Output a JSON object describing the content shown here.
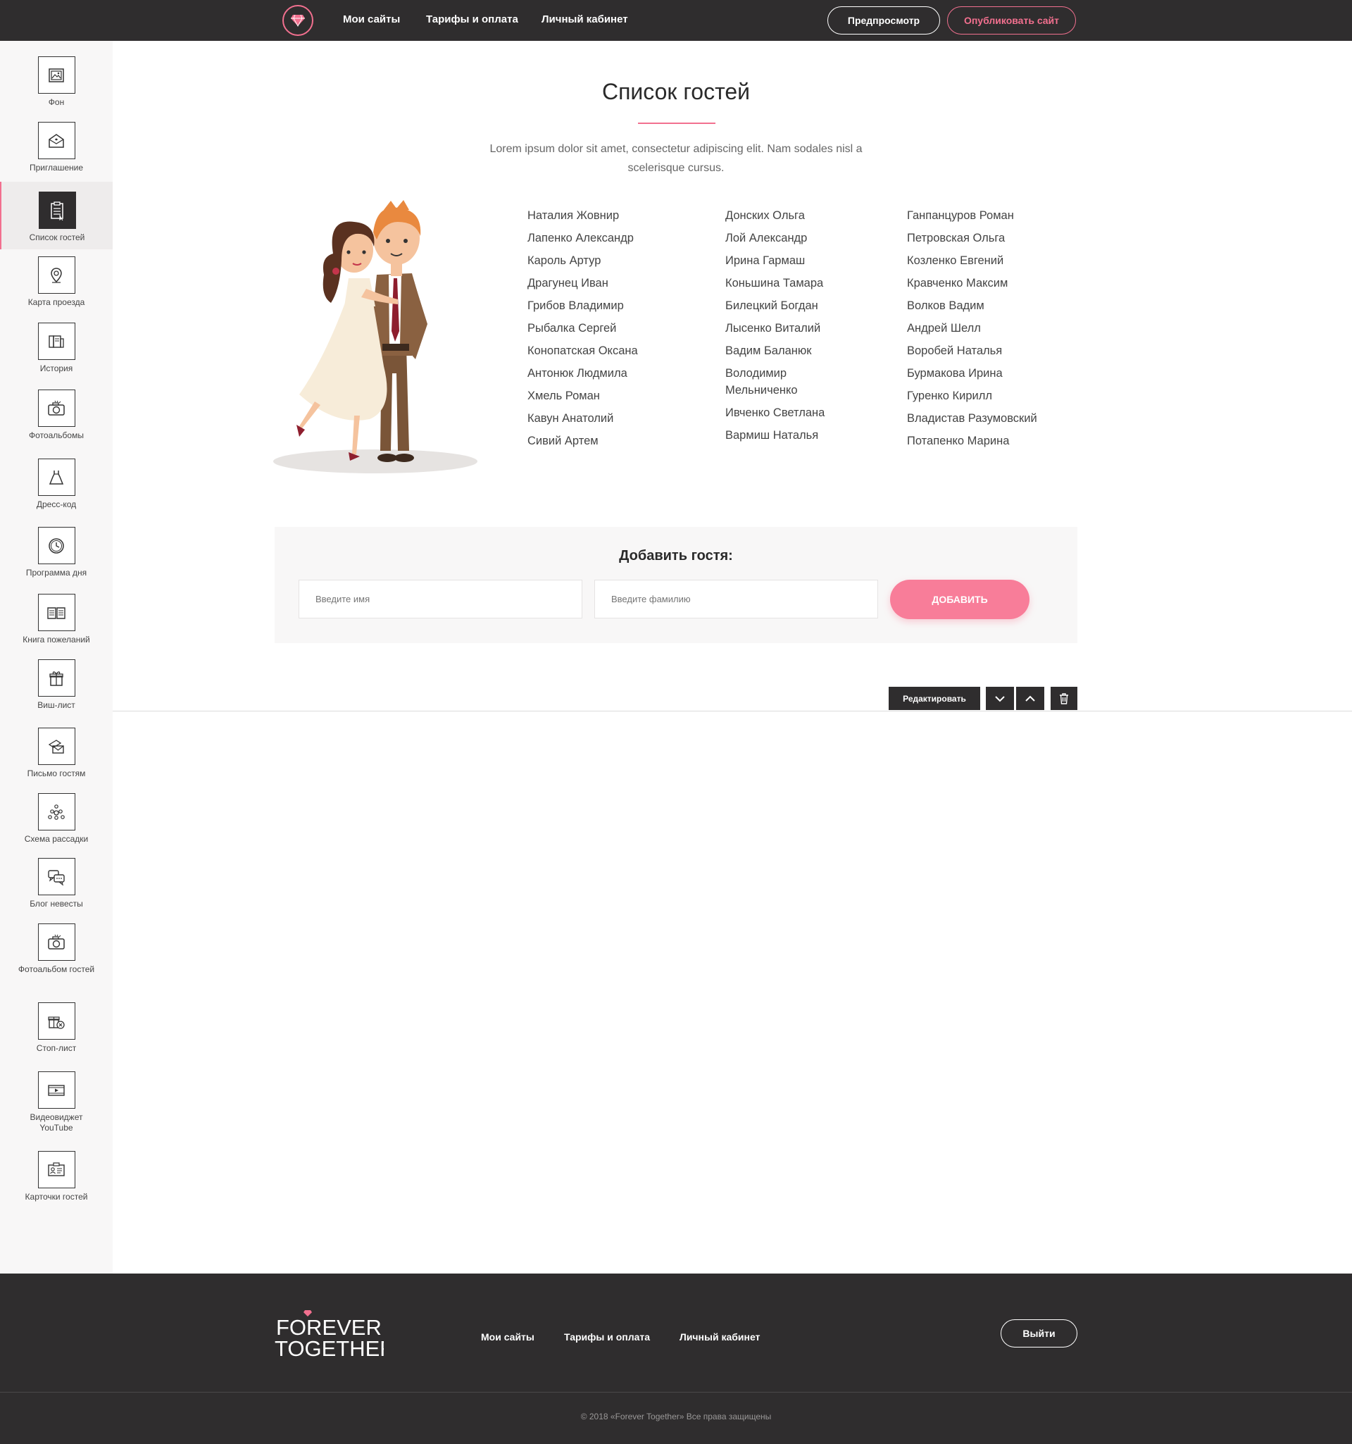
{
  "colors": {
    "accent": "#f2708f",
    "button_pink": "#f87d99",
    "dark_bar": "#2f2d2e",
    "sidebar_bg": "#f8f7f7"
  },
  "header": {
    "logo_icon": "diamond-icon",
    "nav": [
      "Мои сайты",
      "Тарифы и оплата",
      "Личный кабинет"
    ],
    "preview_label": "Предпросмотр",
    "publish_label": "Опубликовать сайт"
  },
  "sidebar": {
    "items": [
      {
        "label": "Фон",
        "icon": "image-icon"
      },
      {
        "label": "Приглашение",
        "icon": "envelope-icon"
      },
      {
        "label": "Список гостей",
        "icon": "clipboard-icon",
        "active": true
      },
      {
        "label": "Карта проезда",
        "icon": "map-pin-icon"
      },
      {
        "label": "История",
        "icon": "book-icon"
      },
      {
        "label": "Фотоальбомы",
        "icon": "camera-icon"
      },
      {
        "label": "Дресс-код",
        "icon": "dress-icon"
      },
      {
        "label": "Программа дня",
        "icon": "clock-icon"
      },
      {
        "label": "Книга пожеланий",
        "icon": "open-book-icon"
      },
      {
        "label": "Виш-лист",
        "icon": "gift-icon"
      },
      {
        "label": "Письмо гостям",
        "icon": "letters-icon"
      },
      {
        "label": "Схема рассадки",
        "icon": "seating-icon"
      },
      {
        "label": "Блог невесты",
        "icon": "chat-icon"
      },
      {
        "label": "Фотоальбом гостей",
        "icon": "camera-icon"
      },
      {
        "label": "Стоп-лист",
        "icon": "gift-cancel-icon"
      },
      {
        "label": "Видеовиджет YouTube",
        "icon": "video-icon"
      },
      {
        "label": "Карточки гостей",
        "icon": "id-card-icon"
      }
    ]
  },
  "main": {
    "title": "Список гостей",
    "subtitle": "Lorem ipsum dolor sit amet, consectetur adipiscing elit. Nam sodales nisl a scelerisque cursus.",
    "guests": [
      [
        "Наталия Жовнир",
        "Лапенко Александр",
        "Кароль Артур",
        "Драгунец Иван",
        "Грибов Владимир",
        "Рыбалка Сергей",
        "Конопатская Оксана",
        "Антонюк Людмила",
        "Хмель Роман",
        "Кавун Анатолий",
        "Сивий Артем"
      ],
      [
        "Донских Ольга",
        "Лой Александр",
        "Ирина Гармаш",
        "Коньшина Тамара",
        "Билецкий Богдан",
        "Лысенко Виталий",
        "Вадим Баланюк",
        "Володимир Мельниченко",
        "Ивченко Светлана",
        "Вармиш Наталья"
      ],
      [
        "Ганпанцуров Роман",
        "Петровская Ольга",
        "Козленко Евгений",
        "Кравченко Максим",
        "Волков Вадим",
        "Андрей Шелл",
        "Воробей Наталья",
        "Бурмакова Ирина",
        "Гуренко Кирилл",
        "Владистав Разумовский",
        "Потапенко Марина"
      ]
    ],
    "add_guest": {
      "title": "Добавить гостя:",
      "first_name_placeholder": "Введите имя",
      "last_name_placeholder": "Введите фамилию",
      "button": "ДОБАВИТЬ"
    },
    "controls": {
      "edit_label": "Редактировать"
    }
  },
  "footer": {
    "logo_line1": "FOREVER",
    "logo_line2": "TOGETHER",
    "nav": [
      "Мои сайты",
      "Тарифы и оплата",
      "Личный кабинет"
    ],
    "logout_label": "Выйти",
    "copyright": "© 2018 «Forever Together» Все права защищены"
  }
}
